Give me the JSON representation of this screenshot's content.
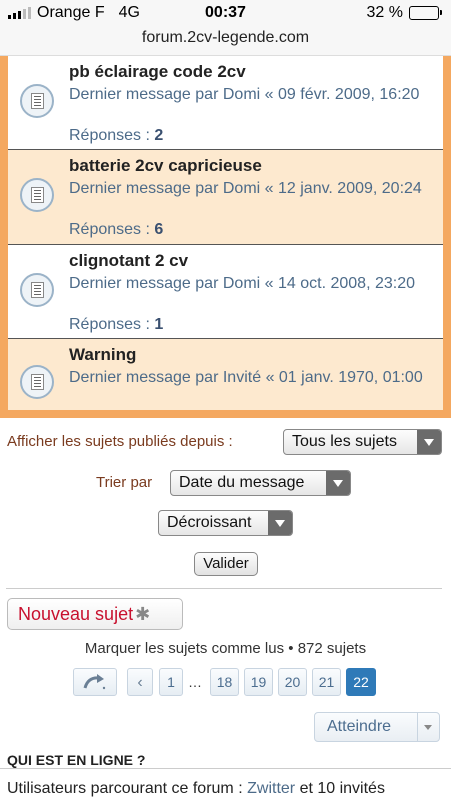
{
  "status_bar": {
    "carrier": "Orange F",
    "network": "4G",
    "time": "00:37",
    "battery_percent": "32 %",
    "battery_level": 0.32,
    "battery_color": "#f2c200"
  },
  "address_bar": {
    "url": "forum.2cv-legende.com"
  },
  "topics": [
    {
      "title": "pb éclairage code 2cv",
      "last_post_prefix": "Dernier message par",
      "author": "Domi",
      "date": "« 09 févr. 2009, 16:20",
      "replies_label": "Réponses :",
      "replies": "2",
      "icon": "topic-read-icon"
    },
    {
      "title": "batterie 2cv capricieuse",
      "last_post_prefix": "Dernier message par",
      "author": "Domi",
      "date": "« 12 janv. 2009, 20:24",
      "replies_label": "Réponses :",
      "replies": "6",
      "icon": "topic-read-icon"
    },
    {
      "title": "clignotant 2 cv",
      "last_post_prefix": "Dernier message par",
      "author": "Domi",
      "date": "« 14 oct. 2008, 23:20",
      "replies_label": "Réponses :",
      "replies": "1",
      "icon": "topic-read-icon"
    },
    {
      "title": "Warning",
      "last_post_prefix": "Dernier message par",
      "author": "Invité",
      "date": "« 01 janv. 1970, 01:00",
      "icon": "topic-read-icon"
    }
  ],
  "sort": {
    "display_label": "Afficher les sujets publiés depuis :",
    "display_value": "Tous les sujets",
    "sort_label": "Trier par",
    "sort_value": "Date du message",
    "order_value": "Décroissant",
    "submit_label": "Valider"
  },
  "actions": {
    "new_topic_label": "Nouveau sujet",
    "new_topic_icon": "asterisk-icon",
    "mark_read_label": "Marquer les sujets comme lus",
    "separator": "•",
    "topic_count": "872 sujets"
  },
  "pagination": {
    "pages": [
      "1",
      "…",
      "18",
      "19",
      "20",
      "21",
      "22"
    ],
    "current": "22",
    "jump_icon": "jump-arrow-icon",
    "prev_icon": "chevron-left-icon"
  },
  "jumpbox": {
    "label": "Atteindre"
  },
  "who_is_online": {
    "title": "QUI EST EN LIGNE ?",
    "prefix": "Utilisateurs parcourant ce forum :",
    "user": "Zwitter",
    "suffix": "et 10 invités"
  },
  "colors": {
    "accent_orange": "#f4a860",
    "row_alt": "#fde9cf",
    "link_blue": "#4d6b89",
    "new_topic_red": "#c8102e",
    "active_page": "#2f7ab8"
  }
}
